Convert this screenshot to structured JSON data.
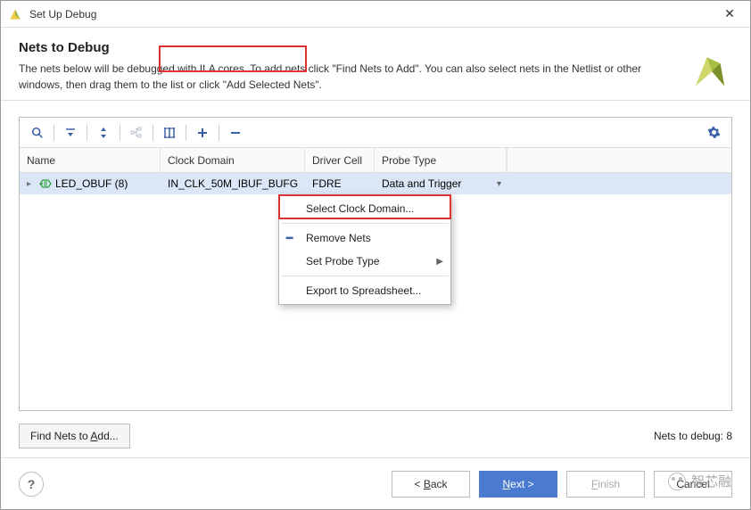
{
  "window": {
    "title": "Set Up Debug"
  },
  "header": {
    "title": "Nets to Debug",
    "desc": "The nets below will be debugged with ILA cores. To add nets click \"Find Nets to Add\". You can also select nets in the Netlist or other windows, then drag them to the list or click \"Add Selected Nets\"."
  },
  "columns": {
    "name": "Name",
    "clock": "Clock Domain",
    "driver": "Driver Cell",
    "probe": "Probe Type"
  },
  "row": {
    "name": "LED_OBUF (8)",
    "clock": "IN_CLK_50M_IBUF_BUFG",
    "driver": "FDRE",
    "probe": "Data and Trigger"
  },
  "context_menu": {
    "select_clock": "Select Clock Domain...",
    "remove": "Remove Nets",
    "set_probe": "Set Probe Type",
    "export": "Export to Spreadsheet..."
  },
  "below": {
    "find_pre": "Find Nets to ",
    "find_key": "A",
    "find_post": "dd...",
    "count_label": "Nets to debug: 8"
  },
  "footer": {
    "back_pre": "< ",
    "back_key": "B",
    "back_post": "ack",
    "next_key": "N",
    "next_post": "ext >",
    "finish_key": "F",
    "finish_post": "inish",
    "cancel": "Cancel"
  },
  "watermark": "智芯融"
}
